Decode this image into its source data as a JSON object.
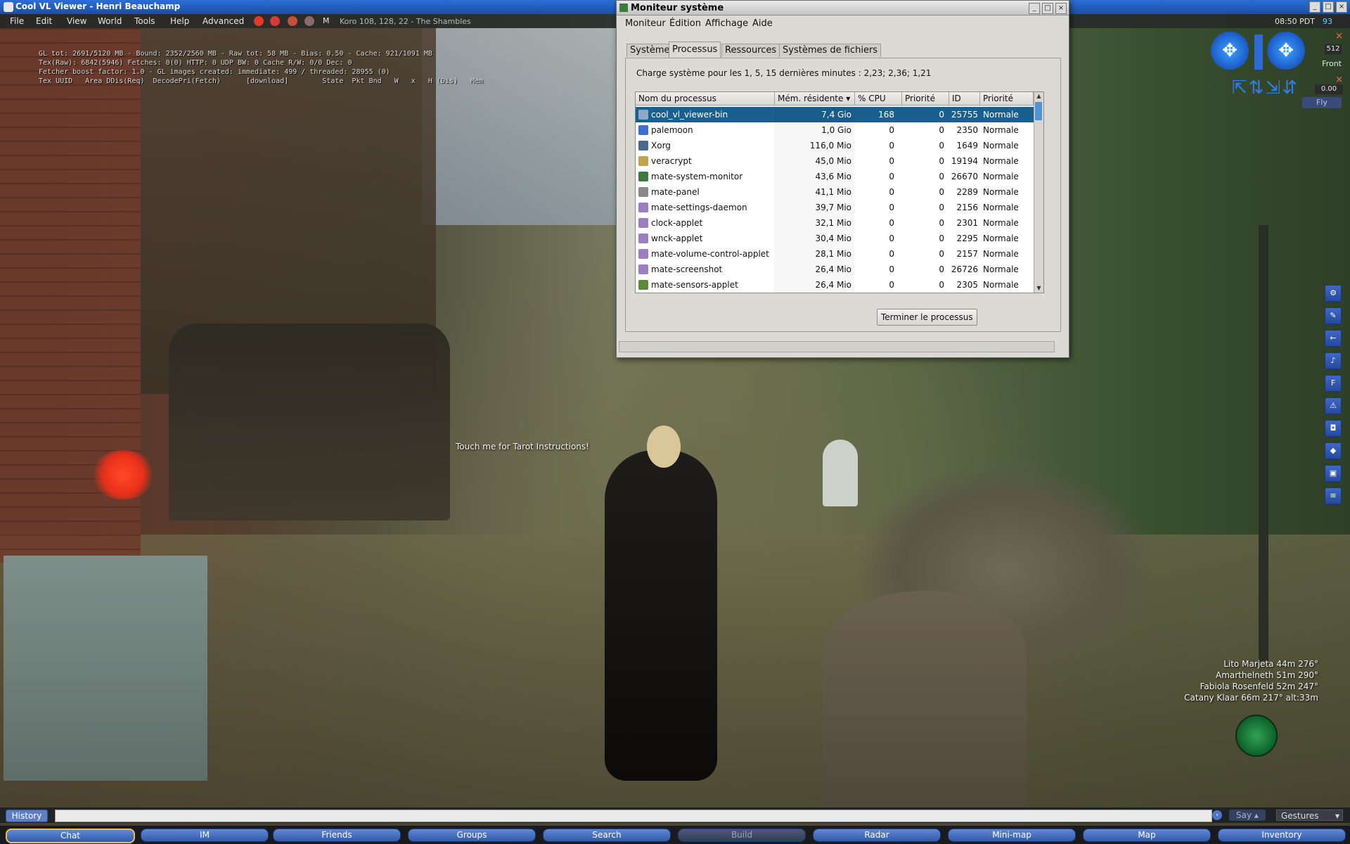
{
  "viewer": {
    "title": "Cool VL Viewer - Henri Beauchamp",
    "menu": [
      "File",
      "Edit",
      "View",
      "World",
      "Tools",
      "Help",
      "Advanced"
    ],
    "toolbar_m": "M",
    "location": "Koro 108, 128, 22 - The Shambles",
    "clock": "08:50 PDT",
    "fps": "93"
  },
  "debug_text": "GL tot: 2691/5120 MB - Bound: 2352/2560 MB - Raw tot: 58 MB - Bias: 0.50 - Cache: 921/1091 MB\nTex(Raw): 6842(5946) Fetches: 0(0) HTTP: 0 UDP BW: 0 Cache R/W: 0/0 Dec: 0\nFetcher boost factor: 1.0 - GL images created: immediate: 499 / threaded: 28955 (0)\nTex UUID   Area DDis(Req)  DecodePri(Fetch)      [download]        State  Pkt Bnd   W   x   H (Dis)   Mem",
  "hover_text": "Touch me for Tarot Instructions!",
  "camera": {
    "zoom_value": "512",
    "front_label": "Front",
    "move_value": "0.00",
    "fly_label": "Fly"
  },
  "radar": [
    "Lito Marjeta 44m 276°",
    "Amarthelneth 51m 290°",
    "Fabiola Rosenfeld 52m 247°",
    "Catany Klaar 66m 217° alt:33m"
  ],
  "chat": {
    "history_label": "History",
    "input_value": "",
    "say_label": "Say",
    "gestures_label": "Gestures"
  },
  "bottom_toolbar": [
    "Chat",
    "IM",
    "Friends",
    "Groups",
    "Search",
    "Build",
    "Radar",
    "Mini-map",
    "Map",
    "Inventory"
  ],
  "sysmon": {
    "title": "Moniteur système",
    "menu": [
      "Moniteur",
      "Édition",
      "Affichage",
      "Aide"
    ],
    "tabs": [
      "Système",
      "Processus",
      "Ressources",
      "Systèmes de fichiers"
    ],
    "load_avg": "Charge système pour les 1, 5, 15 dernières minutes : 2,23; 2,36; 1,21",
    "columns": [
      "Nom du processus",
      "Mém. résidente",
      "% CPU",
      "Priorité",
      "ID",
      "Priorité"
    ],
    "sort_indicator": "▾",
    "end_process_label": "Terminer le processus",
    "processes": [
      {
        "name": "cool_vl_viewer-bin",
        "mem": "7,4 Gio",
        "cpu": "168",
        "nice": "0",
        "id": "25755",
        "prio": "Normale",
        "icon_color": "#8fa8c8"
      },
      {
        "name": "palemoon",
        "mem": "1,0 Gio",
        "cpu": "0",
        "nice": "0",
        "id": "2350",
        "prio": "Normale",
        "icon_color": "#3b6fd0"
      },
      {
        "name": "Xorg",
        "mem": "116,0 Mio",
        "cpu": "0",
        "nice": "0",
        "id": "1649",
        "prio": "Normale",
        "icon_color": "#4a6a8a"
      },
      {
        "name": "veracrypt",
        "mem": "45,0 Mio",
        "cpu": "0",
        "nice": "0",
        "id": "19194",
        "prio": "Normale",
        "icon_color": "#c2a34a"
      },
      {
        "name": "mate-system-monitor",
        "mem": "43,6 Mio",
        "cpu": "0",
        "nice": "0",
        "id": "26670",
        "prio": "Normale",
        "icon_color": "#3d7a3d"
      },
      {
        "name": "mate-panel",
        "mem": "41,1 Mio",
        "cpu": "0",
        "nice": "0",
        "id": "2289",
        "prio": "Normale",
        "icon_color": "#8a8a8a"
      },
      {
        "name": "mate-settings-daemon",
        "mem": "39,7 Mio",
        "cpu": "0",
        "nice": "0",
        "id": "2156",
        "prio": "Normale",
        "icon_color": "#9b7fbf"
      },
      {
        "name": "clock-applet",
        "mem": "32,1 Mio",
        "cpu": "0",
        "nice": "0",
        "id": "2301",
        "prio": "Normale",
        "icon_color": "#9b7fbf"
      },
      {
        "name": "wnck-applet",
        "mem": "30,4 Mio",
        "cpu": "0",
        "nice": "0",
        "id": "2295",
        "prio": "Normale",
        "icon_color": "#9b7fbf"
      },
      {
        "name": "mate-volume-control-applet",
        "mem": "28,1 Mio",
        "cpu": "0",
        "nice": "0",
        "id": "2157",
        "prio": "Normale",
        "icon_color": "#9b7fbf"
      },
      {
        "name": "mate-screenshot",
        "mem": "26,4 Mio",
        "cpu": "0",
        "nice": "0",
        "id": "26726",
        "prio": "Normale",
        "icon_color": "#9b7fbf"
      },
      {
        "name": "mate-sensors-applet",
        "mem": "26,4 Mio",
        "cpu": "0",
        "nice": "0",
        "id": "2305",
        "prio": "Normale",
        "icon_color": "#5b8a3a"
      }
    ]
  },
  "colors": {
    "selection": "#19608f",
    "viewer_title": "#1b4fa6",
    "toolbar_button": "#3359a8"
  }
}
